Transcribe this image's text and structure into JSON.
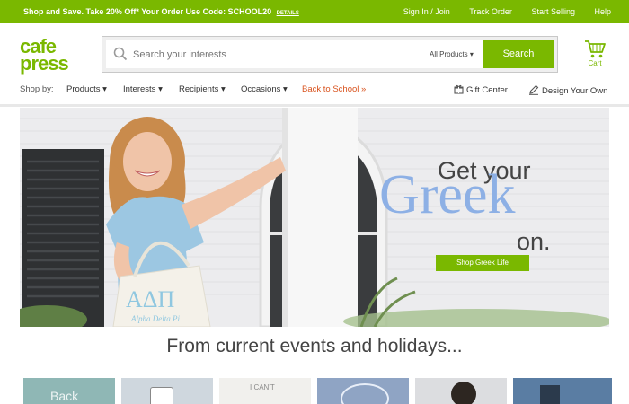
{
  "promo": {
    "message": "Shop and Save. Take 20% Off* Your Order Use Code: SCHOOL20",
    "details": "DETAILS",
    "links": [
      "Sign In / Join",
      "Track Order",
      "Start Selling",
      "Help"
    ]
  },
  "logo": {
    "line1": "cafe",
    "line2": "press"
  },
  "search": {
    "placeholder": "Search your interests",
    "category": "All Products ▾",
    "button": "Search"
  },
  "cart": {
    "label": "Cart"
  },
  "nav": {
    "shop_by": "Shop by:",
    "items": [
      "Products ▾",
      "Interests ▾",
      "Recipients ▾",
      "Occasions ▾"
    ],
    "back_to_school": "Back to School »",
    "gift_center": "Gift Center",
    "design_your_own": "Design Your Own"
  },
  "hero": {
    "line1": "Get your",
    "line2": "Greek",
    "line3": "on.",
    "button": "Shop Greek Life",
    "bag_letters": "ΑΔΠ",
    "bag_script": "Alpha Delta Pi"
  },
  "section": {
    "title": "From current events and holidays..."
  },
  "tiles": [
    {
      "label": "Back",
      "color": "#8fb7b5"
    },
    {
      "label": "",
      "color": "#cfd7de"
    },
    {
      "label": "I CAN'T",
      "color": "#f1f0ed"
    },
    {
      "label": "",
      "color": "#8fa4c4"
    },
    {
      "label": "",
      "color": "#dcdde0"
    },
    {
      "label": "",
      "color": "#5a7da3"
    }
  ],
  "colors": {
    "brand_green": "#7ab800",
    "accent_orange": "#d9531e",
    "greek_blue": "#8db0e5"
  }
}
